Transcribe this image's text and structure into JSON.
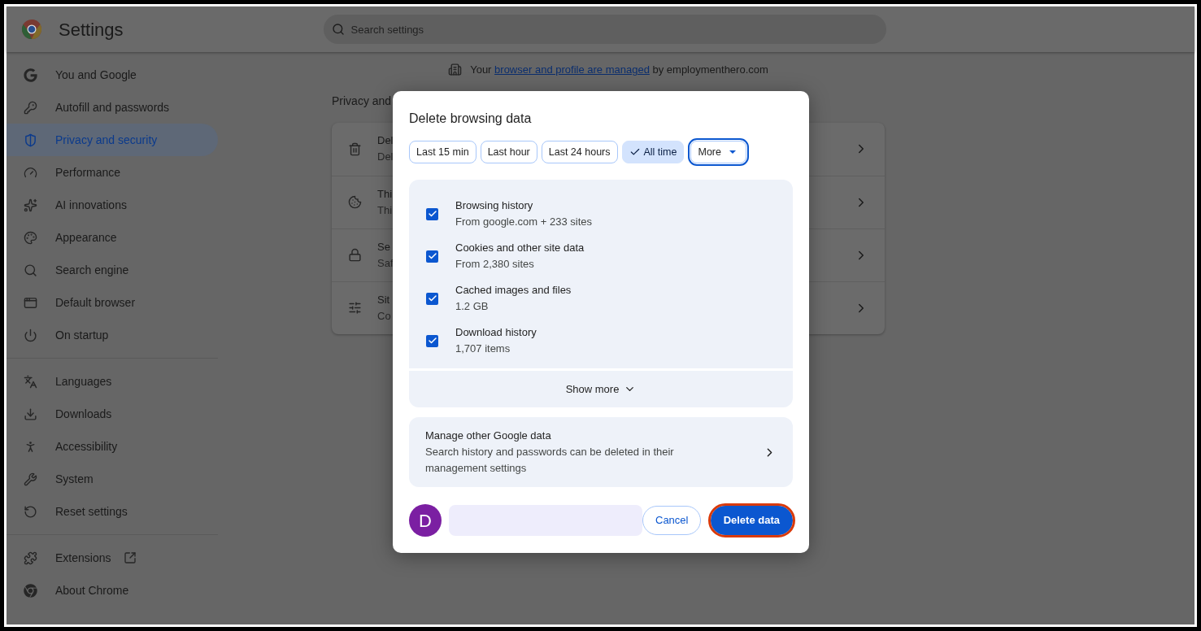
{
  "header": {
    "title": "Settings",
    "search": {
      "placeholder": "Search settings"
    }
  },
  "sidebar": {
    "groups": [
      {
        "items": [
          {
            "label": "You and Google",
            "selected": false
          },
          {
            "label": "Autofill and passwords",
            "selected": false
          },
          {
            "label": "Privacy and security",
            "selected": true
          },
          {
            "label": "Performance",
            "selected": false
          },
          {
            "label": "AI innovations",
            "selected": false
          },
          {
            "label": "Appearance",
            "selected": false
          },
          {
            "label": "Search engine",
            "selected": false
          },
          {
            "label": "Default browser",
            "selected": false
          },
          {
            "label": "On startup",
            "selected": false
          }
        ]
      },
      {
        "items": [
          {
            "label": "Languages",
            "selected": false
          },
          {
            "label": "Downloads",
            "selected": false
          },
          {
            "label": "Accessibility",
            "selected": false
          },
          {
            "label": "System",
            "selected": false
          },
          {
            "label": "Reset settings",
            "selected": false
          }
        ]
      },
      {
        "items": [
          {
            "label": "Extensions",
            "selected": false
          },
          {
            "label": "About Chrome",
            "selected": false
          }
        ]
      }
    ]
  },
  "notice": {
    "before": "Your",
    "link": "browser and profile are managed",
    "after": "by employmenthero.com"
  },
  "section_title": "Privacy and",
  "rows": [
    {
      "title": "Del",
      "subtitle": "Del"
    },
    {
      "title": "Thi",
      "subtitle": "Thi"
    },
    {
      "title": "Se",
      "subtitle": "Saf"
    },
    {
      "title": "Sit",
      "subtitle": "Co"
    }
  ],
  "dialog": {
    "title": "Delete browsing data",
    "ranges": [
      {
        "label": "Last 15 min",
        "selected": false,
        "focused": false,
        "kind": "chip"
      },
      {
        "label": "Last hour",
        "selected": false,
        "focused": false,
        "kind": "chip"
      },
      {
        "label": "Last 24 hours",
        "selected": false,
        "focused": false,
        "kind": "chip"
      },
      {
        "label": "All time",
        "selected": true,
        "focused": false,
        "kind": "chip"
      },
      {
        "label": "More",
        "selected": false,
        "focused": true,
        "kind": "dropdown"
      }
    ],
    "options": [
      {
        "title": "Browsing history",
        "detail": "From google.com + 233 sites",
        "checked": true
      },
      {
        "title": "Cookies and other site data",
        "detail": "From 2,380 sites",
        "checked": true
      },
      {
        "title": "Cached images and files",
        "detail": "1.2 GB",
        "checked": true
      },
      {
        "title": "Download history",
        "detail": "1,707 items",
        "checked": true
      }
    ],
    "show_more": "Show more",
    "manage": {
      "title": "Manage other Google data",
      "detail": "Search history and passwords can be deleted in their management settings"
    },
    "avatar": "D",
    "cancel": "Cancel",
    "delete": {
      "label": "Delete data",
      "highlighted": true
    }
  }
}
